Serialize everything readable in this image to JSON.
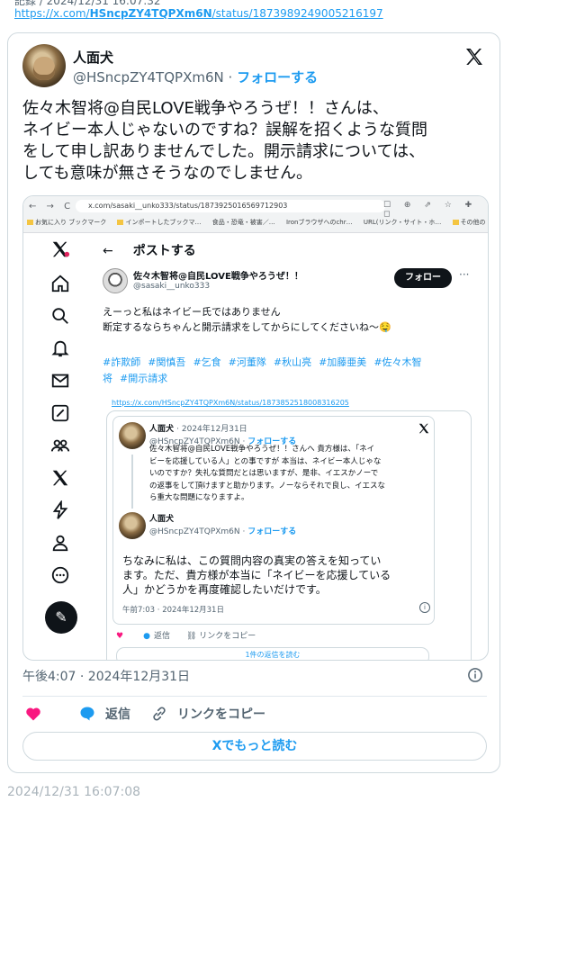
{
  "header": {
    "top_cut_text": "記録 / 2024/12/31 16:07:32",
    "source_link_prefix": "https://x.com/",
    "source_link_handle": "HSncpZY4TQPXm6N",
    "source_link_suffix": "/status/1873989249005216197"
  },
  "tweet": {
    "author_name": "人面犬",
    "author_handle": "@HSncpZY4TQPXm6N",
    "separator": "·",
    "follow_label": "フォローする",
    "text_lines": [
      "佐々木智将@自民LOVE戦争やろうぜ！！さんは、",
      "ネイビー本人じゃないのですね？誤解を招くような質問",
      "をして申し訳ありませんでした。開示請求については、",
      "しても意味が無さそうなのでしません。"
    ],
    "timestamp": "午後4:07 · 2024年12月31日",
    "actions": {
      "reply": "返信",
      "copy_link": "リンクをコピー"
    },
    "read_more": "Xでもっと読む"
  },
  "screenshot": {
    "browser": {
      "nav": "← → C",
      "url": "x.com/sasaki__unko333/status/1873925016569712903",
      "icons": "☐ ⊕ ⇗ ☆ ✚ ◻",
      "bookmarks": [
        "お気に入り ブックマーク",
        "インポートしたブックマ…",
        "食品・恐竜・被害／…",
        "Ironブラウザへのchr…",
        "URL(リンク・サイト・ホ…",
        "その他の"
      ]
    },
    "page_header": {
      "back_arrow": "←",
      "title": "ポストする"
    },
    "post": {
      "author_name": "佐々木智将@自民LOVE戦争やろうぜ！！",
      "author_handle": "@sasaki__unko333",
      "follow_button": "フォロー",
      "more": "···",
      "text_lines": [
        "えーっと私はネイビー氏ではありません",
        "断定するならちゃんと開示請求をしてからにしてくださいね〜🤤"
      ],
      "hashtags": [
        "#詐欺師",
        "#関慎吾",
        "#乞食",
        "#河董隊",
        "#秋山亮",
        "#加藤亜美",
        "#佐々木智",
        "将",
        "#開示請求"
      ],
      "quote_link": "https://x.com/HSncpZY4TQPXm6N/status/1873852518008316205"
    },
    "quote": {
      "first": {
        "name": "人面犬",
        "date": "· 2024年12月31日",
        "handle": "@HSncpZY4TQPXm6N",
        "separator": "·",
        "follow": "フォローする",
        "text_lines": [
          "佐々木智将@自民LOVE戦争やろうぜ！！さんへ 貴方様は、「ネイ",
          "ビーを応援している人」との事ですが 本当は、ネイビー本人じゃな",
          "いのですか？失礼な質問だとは思いますが、是非、イエスかノーで",
          "の返事をして頂けますと助かります。ノーならそれで良し、イエスな",
          "ら重大な問題になりますよ。"
        ]
      },
      "second": {
        "name": "人面犬",
        "handle": "@HSncpZY4TQPXm6N",
        "separator": "·",
        "follow": "フォローする",
        "text_lines": [
          "ちなみに私は、この質問内容の真実の答えを知ってい",
          "ます。ただ、貴方様が本当に「ネイビーを応援している",
          "人」かどうかを再度確認したいだけです。"
        ],
        "time": "午前7:03 · 2024年12月31日",
        "info": "i"
      },
      "actions": {
        "reply": "返信",
        "copy_link": "リンクをコピー"
      },
      "more_replies": "1件の返信を読む"
    }
  },
  "footer": {
    "saved_time": "2024/12/31 16:07:08"
  },
  "colors": {
    "accent": "#1d9bf0",
    "like": "#f91880",
    "text": "#0f1419",
    "muted": "#536471",
    "border": "#cfd9de"
  }
}
